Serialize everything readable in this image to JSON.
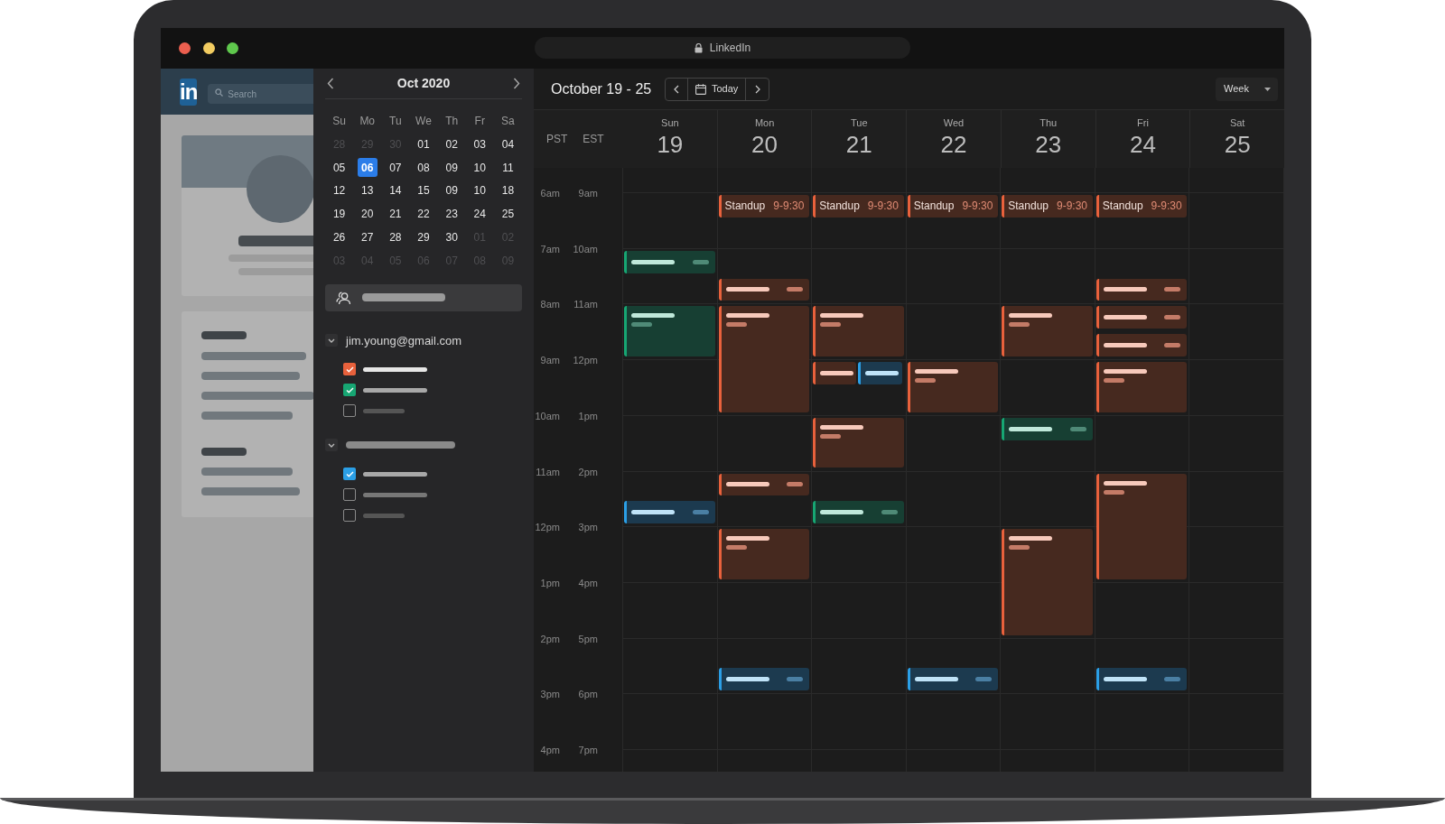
{
  "address_bar": {
    "text": "LinkedIn"
  },
  "linkedin": {
    "logo": "in",
    "search": {
      "placeholder": "Search"
    }
  },
  "mini_calendar": {
    "title": "Oct 2020",
    "weekdays": [
      "Su",
      "Mo",
      "Tu",
      "We",
      "Th",
      "Fr",
      "Sa"
    ],
    "weeks": [
      [
        {
          "label": "28",
          "muted": true,
          "selected": false
        },
        {
          "label": "29",
          "muted": true,
          "selected": false
        },
        {
          "label": "30",
          "muted": true,
          "selected": false
        },
        {
          "label": "01",
          "muted": false,
          "selected": false
        },
        {
          "label": "02",
          "muted": false,
          "selected": false
        },
        {
          "label": "03",
          "muted": false,
          "selected": false
        },
        {
          "label": "04",
          "muted": false,
          "selected": false
        }
      ],
      [
        {
          "label": "05",
          "muted": false,
          "selected": false
        },
        {
          "label": "06",
          "muted": false,
          "selected": true
        },
        {
          "label": "07",
          "muted": false,
          "selected": false
        },
        {
          "label": "08",
          "muted": false,
          "selected": false
        },
        {
          "label": "09",
          "muted": false,
          "selected": false
        },
        {
          "label": "10",
          "muted": false,
          "selected": false
        },
        {
          "label": "11",
          "muted": false,
          "selected": false
        }
      ],
      [
        {
          "label": "12",
          "muted": false,
          "selected": false
        },
        {
          "label": "13",
          "muted": false,
          "selected": false
        },
        {
          "label": "14",
          "muted": false,
          "selected": false
        },
        {
          "label": "15",
          "muted": false,
          "selected": false
        },
        {
          "label": "09",
          "muted": false,
          "selected": false
        },
        {
          "label": "10",
          "muted": false,
          "selected": false
        },
        {
          "label": "18",
          "muted": false,
          "selected": false
        }
      ],
      [
        {
          "label": "19",
          "muted": false,
          "selected": false
        },
        {
          "label": "20",
          "muted": false,
          "selected": false
        },
        {
          "label": "21",
          "muted": false,
          "selected": false
        },
        {
          "label": "22",
          "muted": false,
          "selected": false
        },
        {
          "label": "23",
          "muted": false,
          "selected": false
        },
        {
          "label": "24",
          "muted": false,
          "selected": false
        },
        {
          "label": "25",
          "muted": false,
          "selected": false
        }
      ],
      [
        {
          "label": "26",
          "muted": false,
          "selected": false
        },
        {
          "label": "27",
          "muted": false,
          "selected": false
        },
        {
          "label": "28",
          "muted": false,
          "selected": false
        },
        {
          "label": "29",
          "muted": false,
          "selected": false
        },
        {
          "label": "30",
          "muted": false,
          "selected": false
        },
        {
          "label": "01",
          "muted": true,
          "selected": false
        },
        {
          "label": "02",
          "muted": true,
          "selected": false
        }
      ],
      [
        {
          "label": "03",
          "muted": true,
          "selected": false
        },
        {
          "label": "04",
          "muted": true,
          "selected": false
        },
        {
          "label": "05",
          "muted": true,
          "selected": false
        },
        {
          "label": "06",
          "muted": true,
          "selected": false
        },
        {
          "label": "07",
          "muted": true,
          "selected": false
        },
        {
          "label": "08",
          "muted": true,
          "selected": false
        },
        {
          "label": "09",
          "muted": true,
          "selected": false
        }
      ]
    ]
  },
  "calendars": [
    {
      "label": "jim.young@gmail.com",
      "expanded": true,
      "items": [
        {
          "checked": true,
          "color": "#e8613c"
        },
        {
          "checked": true,
          "color": "#17a673"
        },
        {
          "checked": false
        }
      ]
    },
    {
      "expanded": true,
      "items": [
        {
          "checked": true,
          "color": "#2b9fe6"
        },
        {
          "checked": false
        },
        {
          "checked": false
        }
      ]
    }
  ],
  "toolbar": {
    "range": "October 19 - 25",
    "today": "Today",
    "view": "Week"
  },
  "timezones": [
    "PST",
    "EST"
  ],
  "hours": [
    {
      "pst": "6am",
      "est": "9am"
    },
    {
      "pst": "7am",
      "est": "10am"
    },
    {
      "pst": "8am",
      "est": "11am"
    },
    {
      "pst": "9am",
      "est": "12pm"
    },
    {
      "pst": "10am",
      "est": "1pm"
    },
    {
      "pst": "11am",
      "est": "2pm"
    },
    {
      "pst": "12pm",
      "est": "3pm"
    },
    {
      "pst": "1pm",
      "est": "4pm"
    },
    {
      "pst": "2pm",
      "est": "5pm"
    },
    {
      "pst": "3pm",
      "est": "6pm"
    },
    {
      "pst": "4pm",
      "est": "7pm"
    }
  ],
  "days": [
    {
      "name": "Sun",
      "date": "19",
      "events": [
        {
          "color": "#17a673"
        },
        {
          "color": "#17a673"
        },
        {
          "color": "#2b9fe6"
        }
      ]
    },
    {
      "name": "Mon",
      "date": "20",
      "events": [
        {
          "title": "Standup",
          "time": "9-9:30",
          "color": "#e8613c"
        },
        {
          "color": "#e8613c"
        },
        {
          "color": "#e8613c"
        },
        {
          "color": "#e8613c"
        },
        {
          "color": "#e8613c"
        },
        {
          "color": "#2b9fe6"
        }
      ]
    },
    {
      "name": "Tue",
      "date": "21",
      "events": [
        {
          "title": "Standup",
          "time": "9-9:30",
          "color": "#e8613c"
        },
        {
          "color": "#e8613c"
        },
        {
          "color": "#e8613c"
        },
        {
          "color": "#2b9fe6"
        },
        {
          "color": "#e8613c"
        },
        {
          "color": "#17a673"
        }
      ]
    },
    {
      "name": "Wed",
      "date": "22",
      "events": [
        {
          "title": "Standup",
          "time": "9-9:30",
          "color": "#e8613c"
        },
        {
          "color": "#e8613c"
        },
        {
          "color": "#2b9fe6"
        }
      ]
    },
    {
      "name": "Thu",
      "date": "23",
      "events": [
        {
          "title": "Standup",
          "time": "9-9:30",
          "color": "#e8613c"
        },
        {
          "color": "#e8613c"
        },
        {
          "color": "#17a673"
        },
        {
          "color": "#e8613c"
        }
      ]
    },
    {
      "name": "Fri",
      "date": "24",
      "events": [
        {
          "title": "Standup",
          "time": "9-9:30",
          "color": "#e8613c"
        },
        {
          "color": "#e8613c"
        },
        {
          "color": "#e8613c"
        },
        {
          "color": "#e8613c"
        },
        {
          "color": "#e8613c"
        },
        {
          "color": "#e8613c"
        },
        {
          "color": "#2b9fe6"
        }
      ]
    },
    {
      "name": "Sat",
      "date": "25"
    }
  ]
}
